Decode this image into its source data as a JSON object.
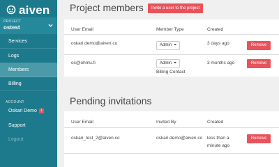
{
  "brand": {
    "name": "aiven",
    "icon": "aiven-logo-icon"
  },
  "project": {
    "caption": "PROJECT",
    "name": "ostest"
  },
  "nav": [
    {
      "label": "Services",
      "active": false
    },
    {
      "label": "Logs",
      "active": false
    },
    {
      "label": "Members",
      "active": true
    },
    {
      "label": "Billing",
      "active": false
    }
  ],
  "account": {
    "caption": "ACCOUNT",
    "user_label": "Oskari Demo",
    "user_badge": "1",
    "support_label": "Support",
    "logout_label": "Logout"
  },
  "members": {
    "title": "Project members",
    "invite_button": "Invite a user to the project",
    "columns": {
      "email": "User Email",
      "type": "Member Type",
      "created": "Created"
    },
    "rows": [
      {
        "email": "oskari.demo@aiven.co",
        "type": "Admin",
        "type_note": "",
        "created": "3 days ago",
        "action": "Remove"
      },
      {
        "email": "os@ohmu.fi",
        "type": "Admin",
        "type_note": "Billing Contact",
        "created": "3 months ago",
        "action": "Remove"
      }
    ]
  },
  "invitations": {
    "title": "Pending invitations",
    "columns": {
      "email": "User Email",
      "invited_by": "Invited By",
      "created": "Created"
    },
    "rows": [
      {
        "email": "oskari_test_2@aiven.co",
        "invited_by": "oskari.demo@aiven.co",
        "created_line1": "less than a",
        "created_line2": "minute ago",
        "action": "Remove"
      }
    ]
  },
  "colors": {
    "sidebar": "#1d7a8c",
    "sidebar_active": "#4a9aaa",
    "accent_red": "#e8535b"
  }
}
